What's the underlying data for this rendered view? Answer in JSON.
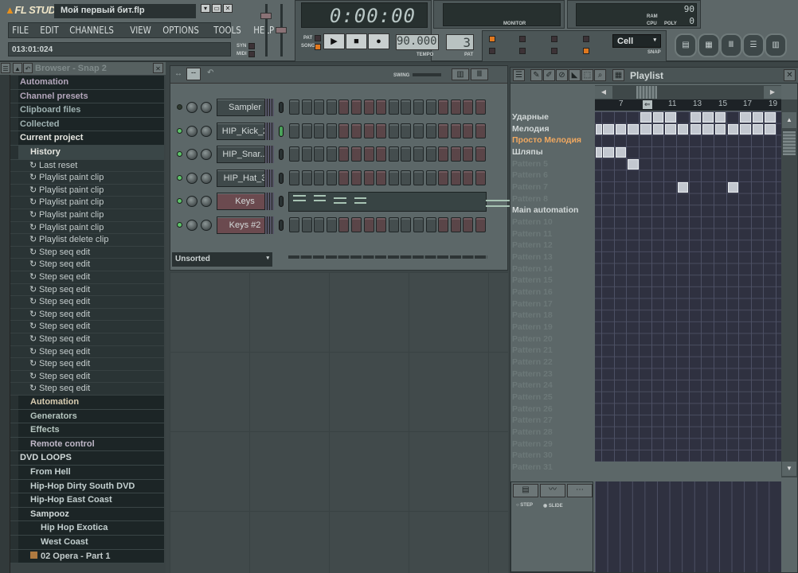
{
  "app": {
    "logo": "FL STUDIO",
    "title": "Мой первый бит.flp",
    "hint": "013:01:024",
    "menu": [
      "FILE",
      "EDIT",
      "CHANNELS",
      "VIEW",
      "OPTIONS",
      "TOOLS",
      "HELP"
    ],
    "syn": "SYN",
    "midi": "MIDI"
  },
  "transport": {
    "time": "0:00:00",
    "pat_label": "PAT",
    "song_label": "SONG",
    "tempo": "90.000",
    "tempo_label": "TEMPO",
    "pattern": "3",
    "pattern_label": "PAT",
    "monitor_label": "MONITOR",
    "cpu_value": "90",
    "ram_label": "RAM",
    "cpu_label": "CPU",
    "poly_label": "POLY",
    "poly_value": "0",
    "snap_value": "Cell",
    "snap_label": "SNAP",
    "accent": "#e0781e"
  },
  "browser": {
    "title": "Browser - Snap 2",
    "items": [
      {
        "t": "Automation",
        "k": "f",
        "lvl": 0,
        "c": "#b3a6bb"
      },
      {
        "t": "Channel presets",
        "k": "f",
        "lvl": 0,
        "c": "#b3a6bb"
      },
      {
        "t": "Clipboard files",
        "k": "f",
        "lvl": 0,
        "c": "#9fb2b2"
      },
      {
        "t": "Collected",
        "k": "f",
        "lvl": 0,
        "c": "#9fb2b2"
      },
      {
        "t": "Current project",
        "k": "f",
        "lvl": 0,
        "c": "#e6e6e0"
      },
      {
        "t": "History",
        "k": "f",
        "lvl": 1,
        "c": "#e6e6e0",
        "sel": true
      },
      {
        "t": "Last reset",
        "k": "h"
      },
      {
        "t": "Playlist paint clip",
        "k": "h"
      },
      {
        "t": "Playlist paint clip",
        "k": "h"
      },
      {
        "t": "Playlist paint clip",
        "k": "h"
      },
      {
        "t": "Playlist paint clip",
        "k": "h"
      },
      {
        "t": "Playlist paint clip",
        "k": "h"
      },
      {
        "t": "Playlist delete clip",
        "k": "h"
      },
      {
        "t": "Step seq edit",
        "k": "h"
      },
      {
        "t": "Step seq edit",
        "k": "h"
      },
      {
        "t": "Step seq edit",
        "k": "h"
      },
      {
        "t": "Step seq edit",
        "k": "h"
      },
      {
        "t": "Step seq edit",
        "k": "h"
      },
      {
        "t": "Step seq edit",
        "k": "h"
      },
      {
        "t": "Step seq edit",
        "k": "h"
      },
      {
        "t": "Step seq edit",
        "k": "h"
      },
      {
        "t": "Step seq edit",
        "k": "h"
      },
      {
        "t": "Step seq edit",
        "k": "h"
      },
      {
        "t": "Step seq edit",
        "k": "h"
      },
      {
        "t": "Step seq edit",
        "k": "h"
      },
      {
        "t": "Automation",
        "k": "f",
        "lvl": 1,
        "c": "#d8ccb0"
      },
      {
        "t": "Generators",
        "k": "f",
        "lvl": 1,
        "c": "#b6c6c0"
      },
      {
        "t": "Effects",
        "k": "f",
        "lvl": 1,
        "c": "#b6c6c0"
      },
      {
        "t": "Remote control",
        "k": "f",
        "lvl": 1,
        "c": "#c0b8c8"
      },
      {
        "t": "DVD LOOPS",
        "k": "f",
        "lvl": 0,
        "c": "#d2dada"
      },
      {
        "t": "From Hell",
        "k": "f",
        "lvl": 1,
        "c": "#c4d0d0"
      },
      {
        "t": "Hip-Hop Dirty South DVD",
        "k": "f",
        "lvl": 1,
        "c": "#c4d0d0"
      },
      {
        "t": "Hip-Hop East Coast",
        "k": "f",
        "lvl": 1,
        "c": "#c4d0d0"
      },
      {
        "t": "Sampooz",
        "k": "f",
        "lvl": 1,
        "c": "#d2dada"
      },
      {
        "t": "Hip Hop Exotica",
        "k": "f",
        "lvl": 2,
        "c": "#c4d0d0"
      },
      {
        "t": "West Coast",
        "k": "f",
        "lvl": 2,
        "c": "#c4d0d0"
      },
      {
        "t": "02 Opera - Part 1",
        "k": "file",
        "lvl": 1,
        "c": "#c4cccc"
      }
    ]
  },
  "rack": {
    "swing_label": "SWING",
    "filter": "Unsorted",
    "channels": [
      {
        "name": "Sampler",
        "red": false,
        "led": false,
        "active": false
      },
      {
        "name": "HIP_Kick_2",
        "red": false,
        "led": true,
        "active": true
      },
      {
        "name": "HIP_Snar...",
        "red": false,
        "led": true,
        "active": false
      },
      {
        "name": "HIP_Hat_3",
        "red": false,
        "led": true,
        "active": false
      },
      {
        "name": "Keys",
        "red": true,
        "led": true,
        "active": false,
        "pianoroll": true
      },
      {
        "name": "Keys #2",
        "red": true,
        "led": true,
        "active": false
      }
    ]
  },
  "playlist": {
    "title": "Playlist",
    "ruler": [
      "7",
      "11",
      "13",
      "15",
      "17",
      "19"
    ],
    "rows": [
      {
        "n": "Ударные",
        "s": "lit"
      },
      {
        "n": "Мелодия",
        "s": "lit"
      },
      {
        "n": "Просто Мелодия",
        "s": "orange"
      },
      {
        "n": "Шляпы",
        "s": "lit"
      },
      {
        "n": "Pattern 5"
      },
      {
        "n": "Pattern 6"
      },
      {
        "n": "Pattern 7"
      },
      {
        "n": "Pattern 8"
      },
      {
        "n": "Main automation",
        "s": "lit"
      },
      {
        "n": "Pattern 10"
      },
      {
        "n": "Pattern 11"
      },
      {
        "n": "Pattern 12"
      },
      {
        "n": "Pattern 13"
      },
      {
        "n": "Pattern 14"
      },
      {
        "n": "Pattern 15"
      },
      {
        "n": "Pattern 16"
      },
      {
        "n": "Pattern 17"
      },
      {
        "n": "Pattern 18"
      },
      {
        "n": "Pattern 19"
      },
      {
        "n": "Pattern 20"
      },
      {
        "n": "Pattern 21"
      },
      {
        "n": "Pattern 22"
      },
      {
        "n": "Pattern 23"
      },
      {
        "n": "Pattern 24"
      },
      {
        "n": "Pattern 25"
      },
      {
        "n": "Pattern 26"
      },
      {
        "n": "Pattern 27"
      },
      {
        "n": "Pattern 28"
      },
      {
        "n": "Pattern 29"
      },
      {
        "n": "Pattern 30"
      },
      {
        "n": "Pattern 31"
      }
    ],
    "clips": [
      {
        "row": 0,
        "cols": [
          4,
          5,
          6,
          8,
          9,
          10,
          12,
          13,
          14
        ]
      },
      {
        "row": 1,
        "cols": [
          0,
          1,
          2,
          3,
          4,
          5,
          6,
          7,
          8,
          9,
          10,
          11,
          12,
          13,
          14
        ]
      },
      {
        "row": 3,
        "cols": [
          0,
          1,
          2
        ]
      },
      {
        "row": 4,
        "cols": [
          3
        ]
      },
      {
        "row": 6,
        "cols": [
          7,
          11
        ]
      }
    ],
    "event": {
      "step": "STEP",
      "slide": "SLIDE"
    }
  }
}
